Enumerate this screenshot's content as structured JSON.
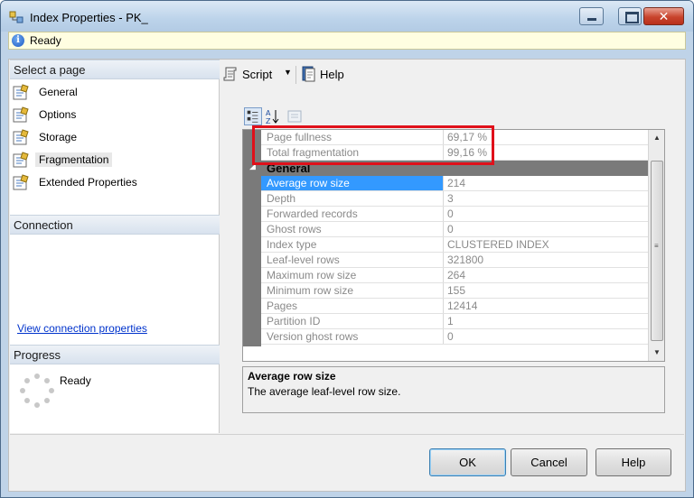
{
  "window": {
    "title": "Index Properties - PK_"
  },
  "status": {
    "text": "Ready"
  },
  "left": {
    "select_page_header": "Select a page",
    "pages": [
      {
        "label": "General",
        "selected": false
      },
      {
        "label": "Options",
        "selected": false
      },
      {
        "label": "Storage",
        "selected": false
      },
      {
        "label": "Fragmentation",
        "selected": true
      },
      {
        "label": "Extended Properties",
        "selected": false
      }
    ],
    "connection_header": "Connection",
    "connection_link": "View connection properties",
    "progress_header": "Progress",
    "progress_text": "Ready"
  },
  "toolbar": {
    "script_label": "Script",
    "help_label": "Help"
  },
  "grid": {
    "top_rows": [
      {
        "name": "Page fullness",
        "value": "69,17 %"
      },
      {
        "name": "Total fragmentation",
        "value": "99,16 %"
      }
    ],
    "category": "General",
    "rows": [
      {
        "name": "Average row size",
        "value": "214"
      },
      {
        "name": "Depth",
        "value": "3"
      },
      {
        "name": "Forwarded records",
        "value": "0"
      },
      {
        "name": "Ghost rows",
        "value": "0"
      },
      {
        "name": "Index type",
        "value": "CLUSTERED INDEX"
      },
      {
        "name": "Leaf-level rows",
        "value": "321800"
      },
      {
        "name": "Maximum row size",
        "value": "264"
      },
      {
        "name": "Minimum row size",
        "value": "155"
      },
      {
        "name": "Pages",
        "value": "12414"
      },
      {
        "name": "Partition ID",
        "value": "1"
      },
      {
        "name": "Version ghost rows",
        "value": "0"
      }
    ]
  },
  "description": {
    "title": "Average row size",
    "text": "The average leaf-level row size."
  },
  "buttons": {
    "ok": "OK",
    "cancel": "Cancel",
    "help": "Help"
  },
  "colors": {
    "highlight": "#e0101a",
    "selection": "#3399ff",
    "link": "#0033cc"
  }
}
